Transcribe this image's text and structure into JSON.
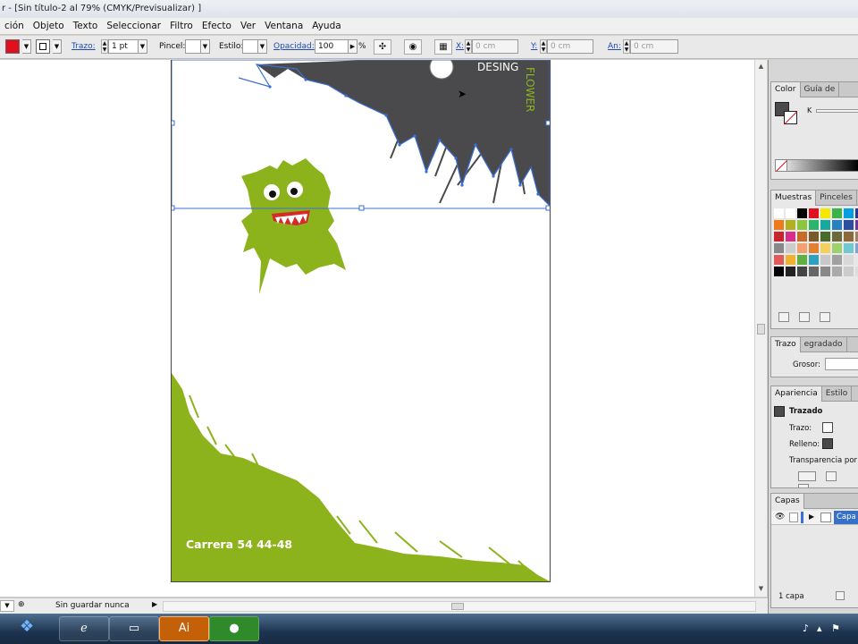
{
  "window": {
    "title": "r - [Sin título-2 al 79% (CMYK/Previsualizar) ]"
  },
  "menu": [
    "ción",
    "Objeto",
    "Texto",
    "Seleccionar",
    "Filtro",
    "Efecto",
    "Ver",
    "Ventana",
    "Ayuda"
  ],
  "control_bar": {
    "trazo_label": "Trazo:",
    "trazo_value": "1 pt",
    "pincel_label": "Pincel:",
    "estilo_label": "Estilo:",
    "opacidad_label": "Opacidad:",
    "opacidad_value": "100",
    "percent": "%",
    "x_label": "X:",
    "x_value": "0 cm",
    "y_label": "Y:",
    "y_value": "0 cm",
    "an_label": "An:",
    "an_value": "0 cm",
    "fill_color": "#e0101e"
  },
  "artwork": {
    "desing_text": "DESING",
    "flower_text": "FLOWER",
    "address": "Carrera 54 44-48",
    "green": "#8cb31c",
    "dark": "#4a4a4c",
    "selection_blue": "#3a6fd8"
  },
  "status": {
    "text": "Sin guardar nunca"
  },
  "panels": {
    "color": {
      "tabs": [
        "Color",
        "Guía de"
      ],
      "k_label": "K"
    },
    "muestras": {
      "tabs": [
        "Muestras",
        "Pinceles"
      ]
    },
    "trazo": {
      "tabs": [
        "Trazo",
        "egradado"
      ],
      "grosor_label": "Grosor:"
    },
    "apariencia": {
      "tabs": [
        "Apariencia",
        "Estilo"
      ],
      "heading": "Trazado",
      "trazo_label": "Trazo:",
      "relleno_label": "Relleno:",
      "transparencia_label": "Transparencia por d"
    },
    "capas": {
      "tabs": [
        "Capas"
      ],
      "layer_label": "Capa",
      "count": "1 capa"
    }
  },
  "taskbar": {
    "ai_label": "Ai"
  },
  "swatches": [
    "#ffffff",
    "#ffffff",
    "#000000",
    "#e0101e",
    "#f7e600",
    "#3bb34a",
    "#00a0e0",
    "#2a3590",
    "#e6168a",
    "#ee7a1a",
    "#b0b020",
    "#8cc63e",
    "#2db46b",
    "#19a89d",
    "#2a7fc0",
    "#2a4fa0",
    "#6a3a9a",
    "#9e2e8e",
    "#c8242e",
    "#d6308a",
    "#c86a2a",
    "#7a5a2a",
    "#4a6a2a",
    "#6a6a3a",
    "#8a6a3a",
    "#a08060",
    "#c0a080",
    "#888888",
    "#cccccc",
    "#f2a070",
    "#e08030",
    "#f4d060",
    "#9ed070",
    "#70c8d0",
    "#80a0d8",
    "#b090c8",
    "#e05a5a",
    "#f0b030",
    "#60b040",
    "#30a0c0",
    "#c8c8c8",
    "#a0a0a0",
    "#d8d8d8",
    "#e8e8e8",
    "#b8b8b8",
    "#000000",
    "#222222",
    "#444444",
    "#666666",
    "#888888",
    "#aaaaaa",
    "#cccccc",
    "#dddddd",
    "#eeeeee"
  ]
}
